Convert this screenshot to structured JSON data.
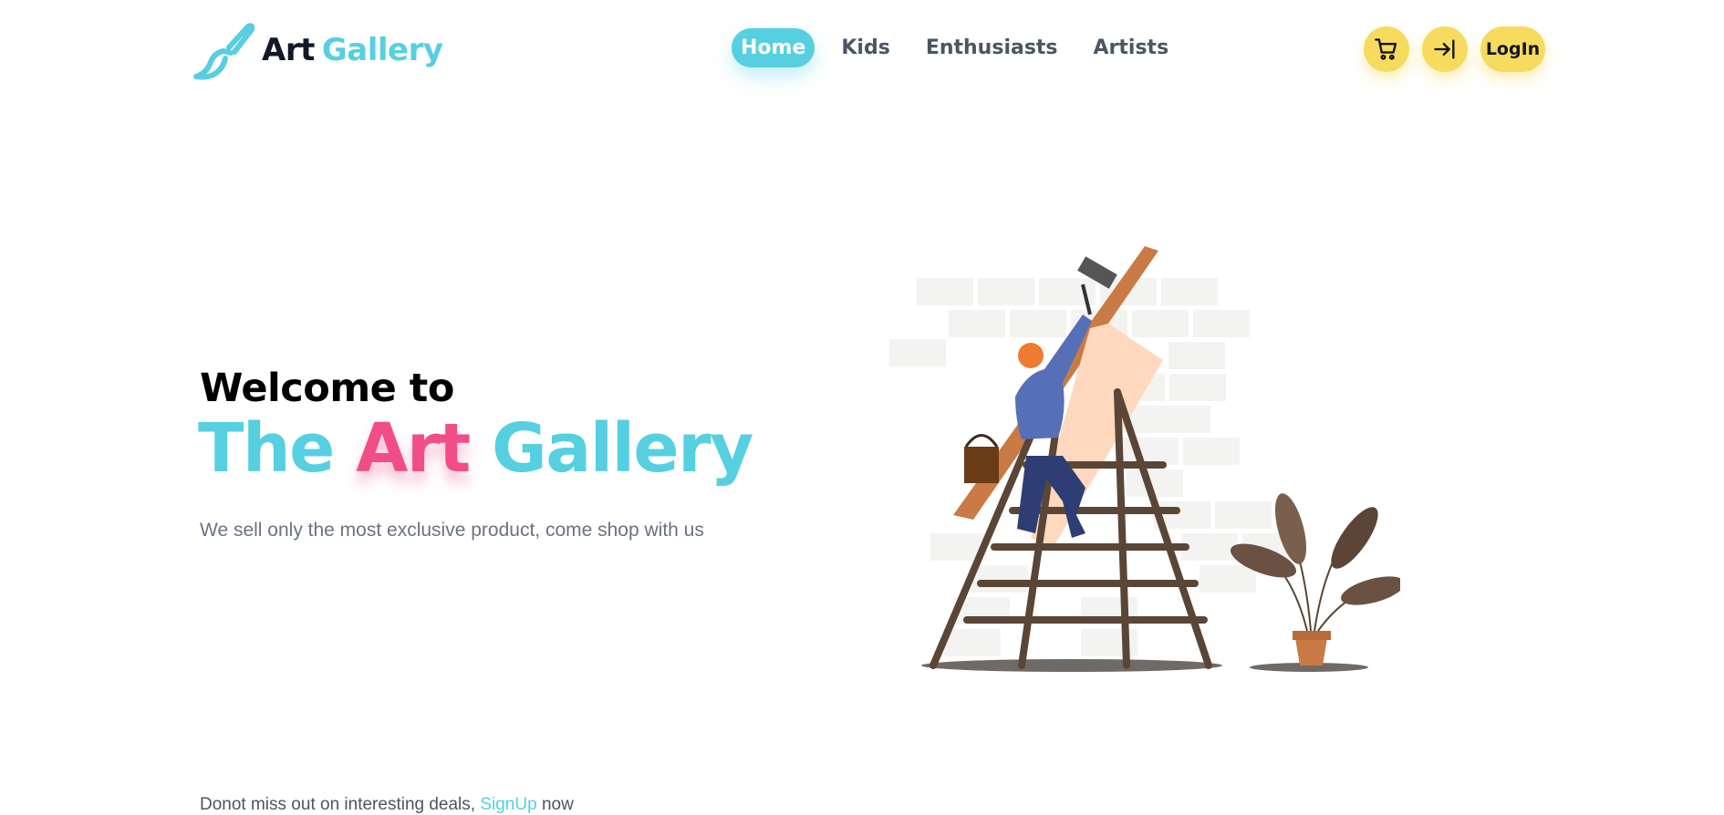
{
  "brand": {
    "name_part1": "Art",
    "name_part2": "Gallery",
    "colors": {
      "accent": "#56cfe1",
      "pink": "#f14d87",
      "yellow": "#f6db5e",
      "dark": "#111827"
    }
  },
  "nav": {
    "items": [
      {
        "label": "Home",
        "active": true
      },
      {
        "label": "Kids",
        "active": false
      },
      {
        "label": "Enthusiasts",
        "active": false
      },
      {
        "label": "Artists",
        "active": false
      }
    ]
  },
  "actions": {
    "cart_icon": "cart-icon",
    "signin_icon": "sign-in-icon",
    "login_label": "LogIn"
  },
  "hero": {
    "welcome": "Welcome to",
    "title_part1": "The",
    "title_part2": "Art",
    "title_part3": "Gallery",
    "subtitle": "We sell only the most exclusive product, come shop with us"
  },
  "footer": {
    "text_before": "Donot miss out on interesting deals,",
    "link": "SignUp",
    "text_after": "now"
  }
}
